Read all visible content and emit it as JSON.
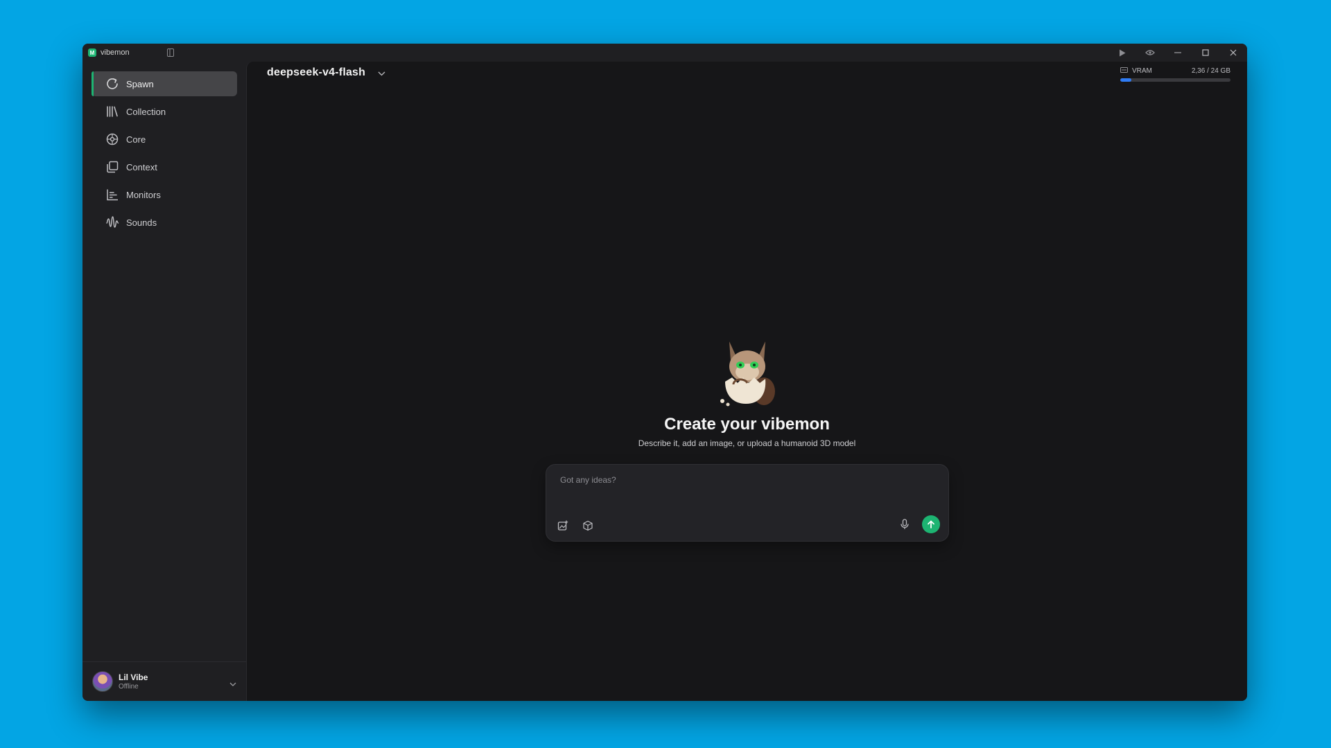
{
  "app": {
    "title": "vibemon",
    "logo_letter": "M"
  },
  "window_controls": [
    "play-icon",
    "eye-icon",
    "minimize-icon",
    "maximize-icon",
    "close-icon"
  ],
  "sidebar": {
    "items": [
      {
        "label": "Spawn",
        "icon": "spawn-icon",
        "active": true
      },
      {
        "label": "Collection",
        "icon": "collection-icon",
        "active": false
      },
      {
        "label": "Core",
        "icon": "core-icon",
        "active": false
      },
      {
        "label": "Context",
        "icon": "context-icon",
        "active": false
      },
      {
        "label": "Monitors",
        "icon": "monitors-icon",
        "active": false
      },
      {
        "label": "Sounds",
        "icon": "sounds-icon",
        "active": false
      }
    ],
    "user": {
      "name": "Lil Vibe",
      "status": "Offline"
    }
  },
  "header": {
    "model_name": "deepseek-v4-flash"
  },
  "vram": {
    "label": "VRAM",
    "value_text": "2,36 / 24 GB",
    "fraction": 0.098
  },
  "hero": {
    "title": "Create your vibemon",
    "subtitle": "Describe it, add an image, or upload a humanoid 3D model"
  },
  "composer": {
    "placeholder": "Got any ideas?",
    "value": "",
    "tools": [
      "add-image-icon",
      "3d-model-icon",
      "microphone-icon",
      "send-icon"
    ]
  },
  "colors": {
    "accent": "#1db472",
    "vram_bar": "#2f7cf5",
    "desktop": "#03a5e4",
    "window_bg": "#1f1f22",
    "main_bg": "#161618"
  }
}
